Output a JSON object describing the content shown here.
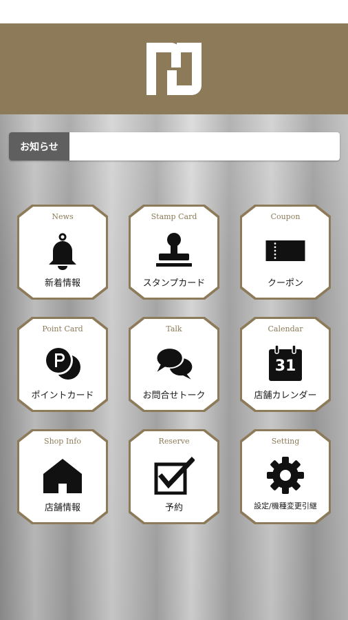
{
  "header": {
    "logo": "brand-logo"
  },
  "notice": {
    "label": "お知らせ",
    "text": ""
  },
  "menu": [
    {
      "en": "News",
      "jp": "新着情報",
      "icon": "bell-icon"
    },
    {
      "en": "Stamp Card",
      "jp": "スタンプカード",
      "icon": "stamp-icon"
    },
    {
      "en": "Coupon",
      "jp": "クーポン",
      "icon": "ticket-icon"
    },
    {
      "en": "Point Card",
      "jp": "ポイントカード",
      "icon": "point-coin-icon"
    },
    {
      "en": "Talk",
      "jp": "お問合せトーク",
      "icon": "chat-bubbles-icon"
    },
    {
      "en": "Calendar",
      "jp": "店舗カレンダー",
      "icon": "calendar-icon",
      "day": "31"
    },
    {
      "en": "Shop Info",
      "jp": "店舗情報",
      "icon": "house-icon"
    },
    {
      "en": "Reserve",
      "jp": "予約",
      "icon": "checkbox-icon"
    },
    {
      "en": "Setting",
      "jp": "設定/機種変更引継",
      "icon": "gear-icon"
    }
  ],
  "colors": {
    "accent": "#8c7a58",
    "notice_label_bg": "#5f5f5f"
  }
}
